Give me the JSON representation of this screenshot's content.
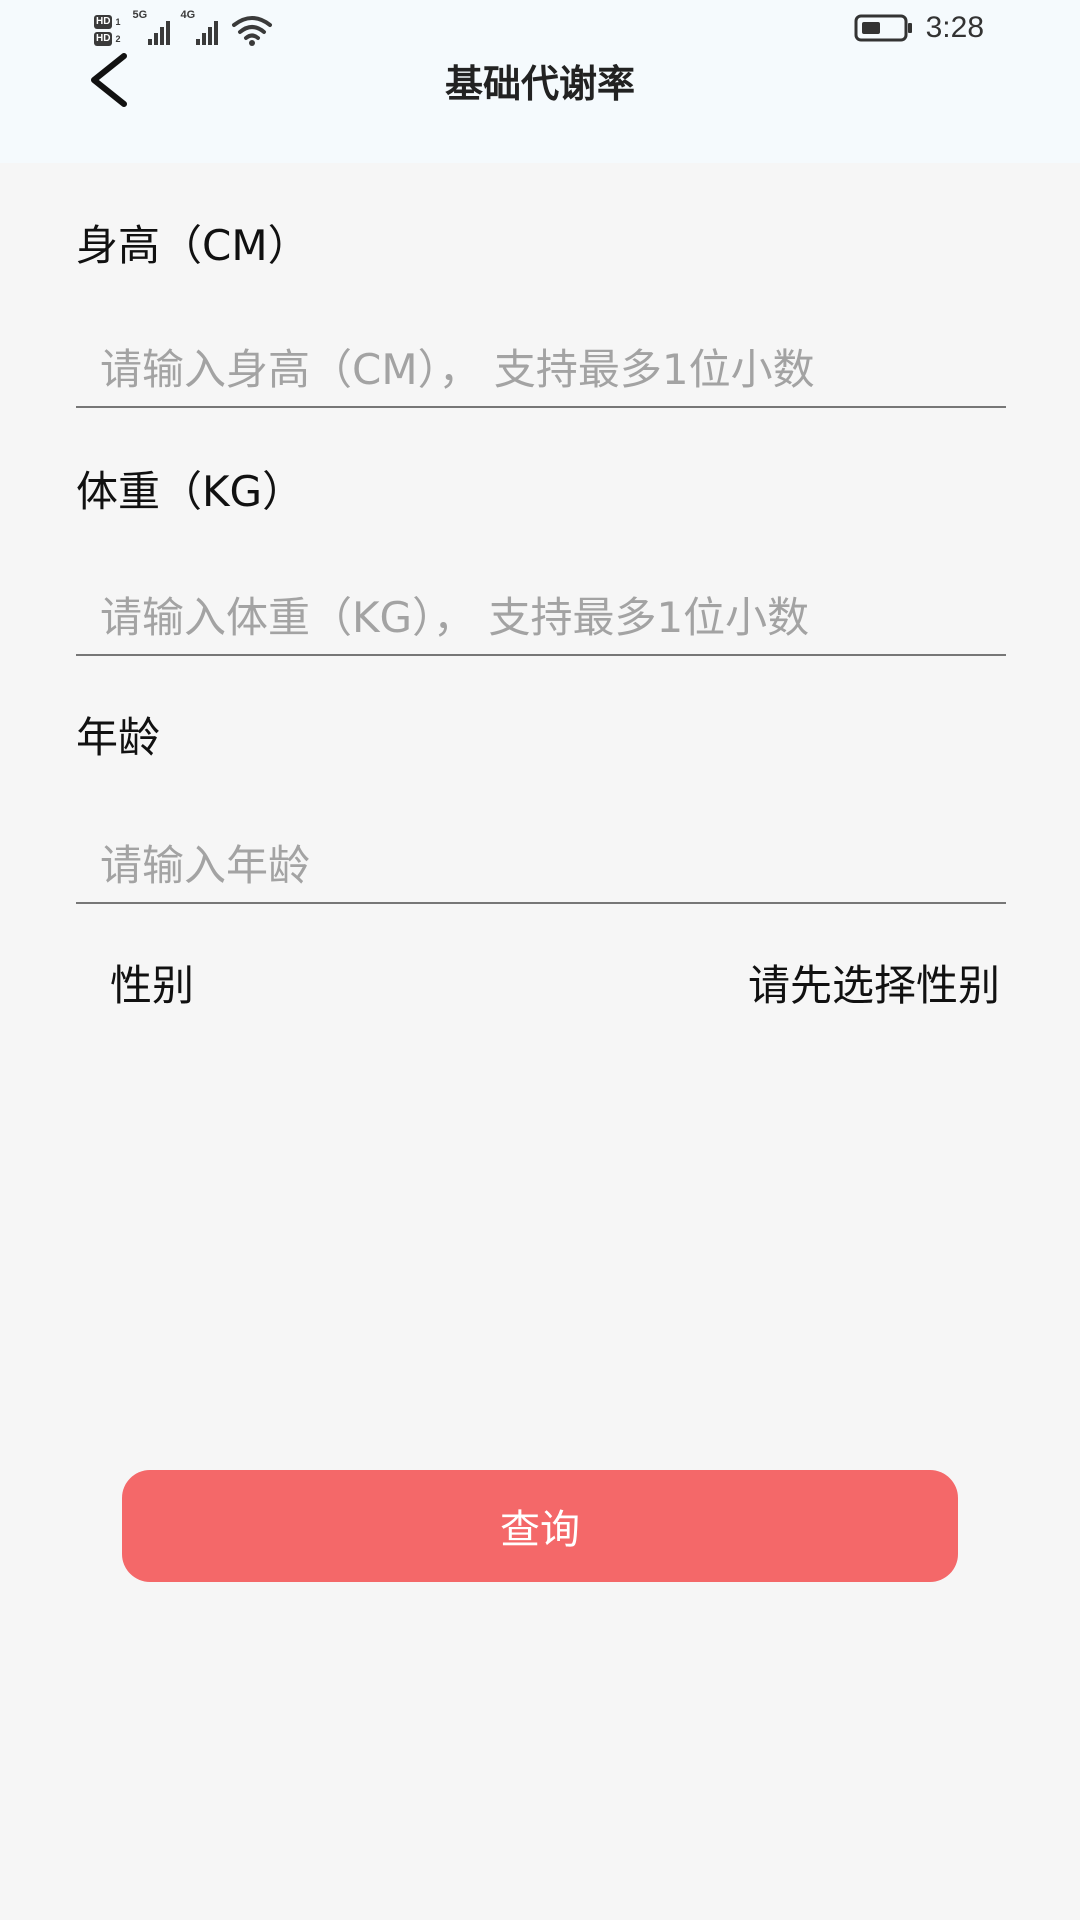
{
  "status_bar": {
    "sim1_label": "HD",
    "sim1_index": "1",
    "sim2_label": "HD",
    "sim2_index": "2",
    "network1": "5G",
    "network2": "4G",
    "time": "3:28"
  },
  "header": {
    "title": "基础代谢率"
  },
  "form": {
    "height": {
      "label": "身高（CM）",
      "placeholder": "请输入身高（CM）， 支持最多1位小数",
      "value": ""
    },
    "weight": {
      "label": "体重（KG）",
      "placeholder": "请输入体重（KG）， 支持最多1位小数",
      "value": ""
    },
    "age": {
      "label": "年龄",
      "placeholder": "请输入年龄",
      "value": ""
    },
    "gender": {
      "label": "性别",
      "selector_text": "请先选择性别"
    }
  },
  "actions": {
    "query_label": "查询"
  },
  "colors": {
    "header_bg": "#f5fafd",
    "page_bg": "#f6f6f6",
    "accent": "#f46869"
  }
}
